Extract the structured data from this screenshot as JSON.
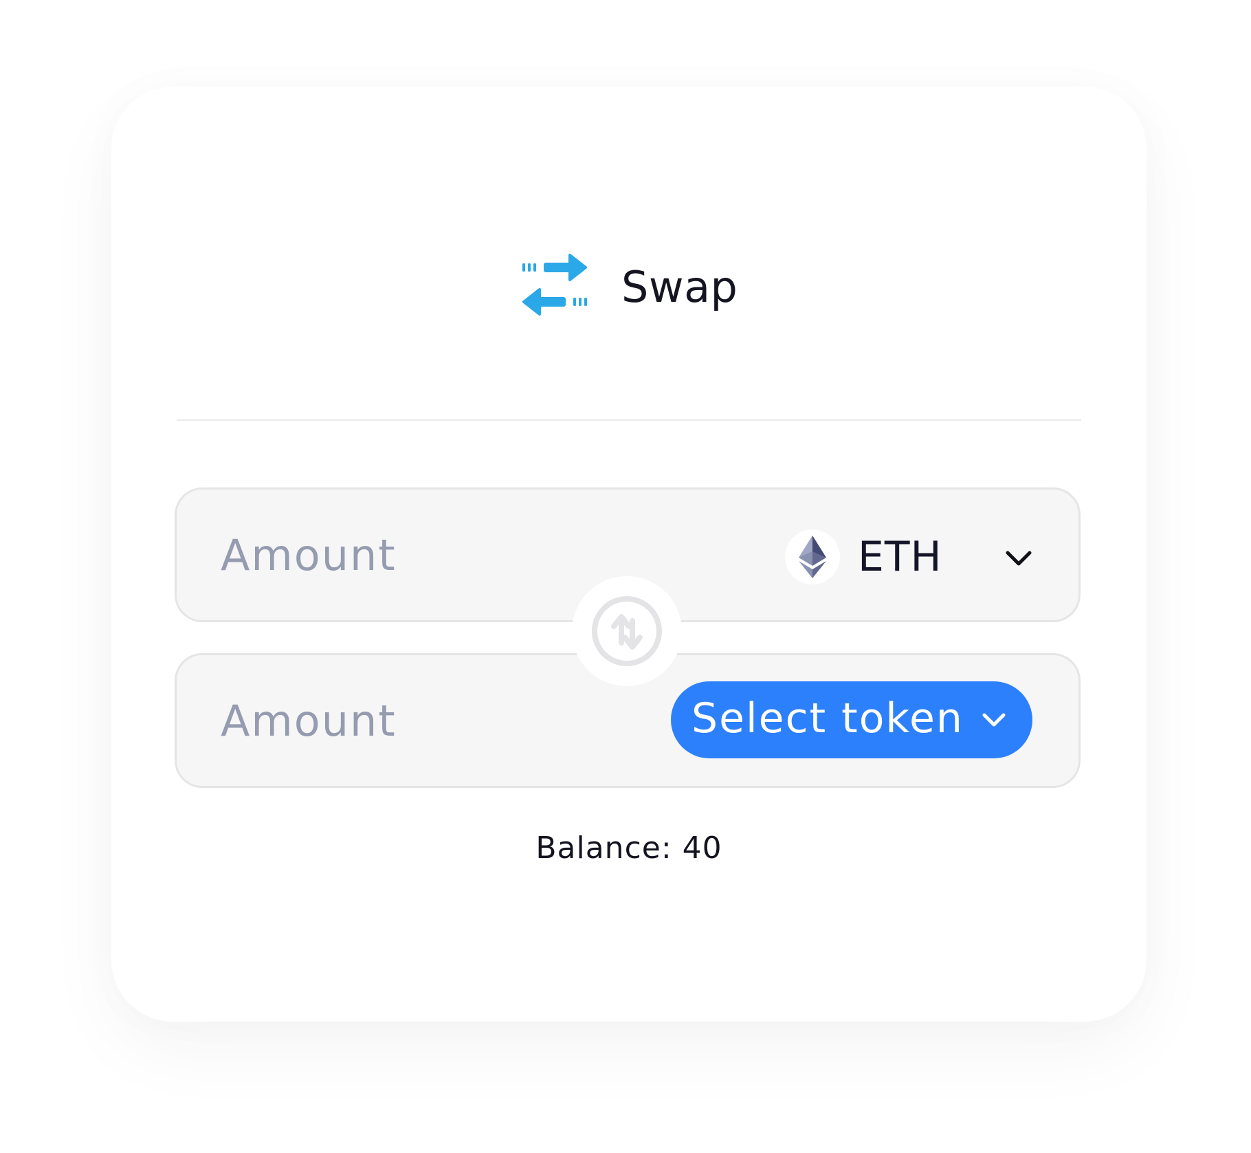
{
  "header": {
    "title": "Swap",
    "icon": "swap-arrows-icon",
    "icon_color": "#2aa8e8"
  },
  "from_field": {
    "amount_placeholder": "Amount",
    "amount_value": "",
    "token_symbol": "ETH",
    "token_icon": "ethereum-icon",
    "dropdown_icon": "chevron-down-icon"
  },
  "switch": {
    "icon": "switch-direction-icon"
  },
  "to_field": {
    "amount_placeholder": "Amount",
    "amount_value": "",
    "select_token_label": "Select token",
    "button_color": "#2d80fb",
    "dropdown_icon": "chevron-down-icon"
  },
  "balance_text": "Balance: 40"
}
